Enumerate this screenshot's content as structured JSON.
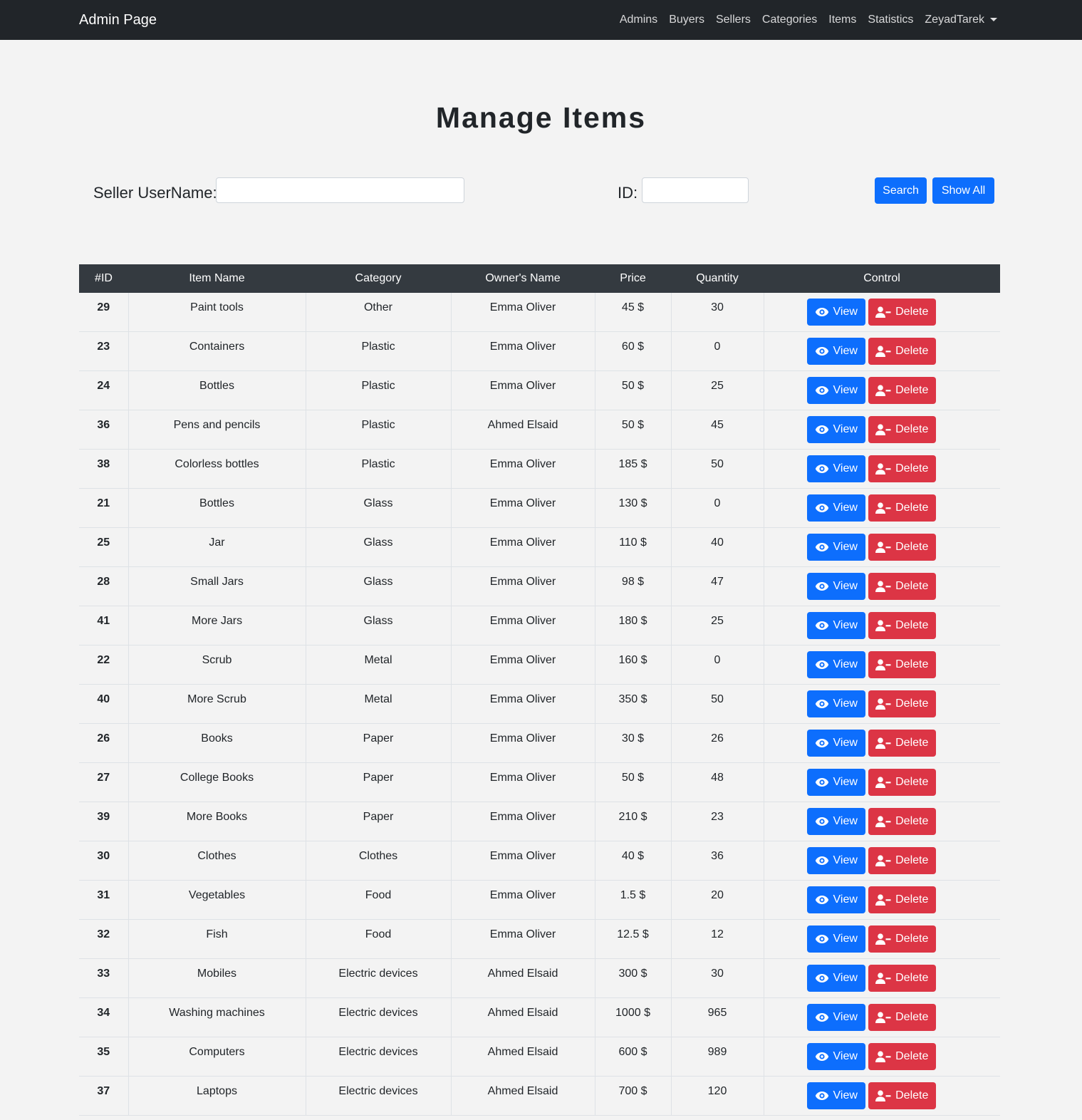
{
  "nav": {
    "brand": "Admin Page",
    "links": [
      "Admins",
      "Buyers",
      "Sellers",
      "Categories",
      "Items",
      "Statistics"
    ],
    "user": "ZeyadTarek"
  },
  "page_title": "Manage Items",
  "search": {
    "seller_label": "Seller UserName:",
    "seller_value": "",
    "id_label": "ID:",
    "id_value": "",
    "search_button": "Search",
    "show_all_button": "Show All"
  },
  "table": {
    "headers": [
      "#ID",
      "Item Name",
      "Category",
      "Owner's Name",
      "Price",
      "Quantity",
      "Control"
    ],
    "view_label": "View",
    "delete_label": "Delete",
    "rows": [
      [
        "29",
        "Paint tools",
        "Other",
        "Emma Oliver",
        "45 $",
        "30"
      ],
      [
        "23",
        "Containers",
        "Plastic",
        "Emma Oliver",
        "60 $",
        "0"
      ],
      [
        "24",
        "Bottles",
        "Plastic",
        "Emma Oliver",
        "50 $",
        "25"
      ],
      [
        "36",
        "Pens and pencils",
        "Plastic",
        "Ahmed Elsaid",
        "50 $",
        "45"
      ],
      [
        "38",
        "Colorless bottles",
        "Plastic",
        "Emma Oliver",
        "185 $",
        "50"
      ],
      [
        "21",
        "Bottles",
        "Glass",
        "Emma Oliver",
        "130 $",
        "0"
      ],
      [
        "25",
        "Jar",
        "Glass",
        "Emma Oliver",
        "110 $",
        "40"
      ],
      [
        "28",
        "Small Jars",
        "Glass",
        "Emma Oliver",
        "98 $",
        "47"
      ],
      [
        "41",
        "More Jars",
        "Glass",
        "Emma Oliver",
        "180 $",
        "25"
      ],
      [
        "22",
        "Scrub",
        "Metal",
        "Emma Oliver",
        "160 $",
        "0"
      ],
      [
        "40",
        "More Scrub",
        "Metal",
        "Emma Oliver",
        "350 $",
        "50"
      ],
      [
        "26",
        "Books",
        "Paper",
        "Emma Oliver",
        "30 $",
        "26"
      ],
      [
        "27",
        "College Books",
        "Paper",
        "Emma Oliver",
        "50 $",
        "48"
      ],
      [
        "39",
        "More Books",
        "Paper",
        "Emma Oliver",
        "210 $",
        "23"
      ],
      [
        "30",
        "Clothes",
        "Clothes",
        "Emma Oliver",
        "40 $",
        "36"
      ],
      [
        "31",
        "Vegetables",
        "Food",
        "Emma Oliver",
        "1.5 $",
        "20"
      ],
      [
        "32",
        "Fish",
        "Food",
        "Emma Oliver",
        "12.5 $",
        "12"
      ],
      [
        "33",
        "Mobiles",
        "Electric devices",
        "Ahmed Elsaid",
        "300 $",
        "30"
      ],
      [
        "34",
        "Washing machines",
        "Electric devices",
        "Ahmed Elsaid",
        "1000 $",
        "965"
      ],
      [
        "35",
        "Computers",
        "Electric devices",
        "Ahmed Elsaid",
        "600 $",
        "989"
      ],
      [
        "37",
        "Laptops",
        "Electric devices",
        "Ahmed Elsaid",
        "700 $",
        "120"
      ]
    ]
  },
  "icons": {
    "view": "eye-icon",
    "delete": "user-minus-icon",
    "dropdown": "caret-down-icon"
  },
  "colors": {
    "navbar": "#212529",
    "table_header": "#343a40",
    "primary": "#0d6efd",
    "danger": "#dc3545",
    "background": "#f3f3f3"
  }
}
